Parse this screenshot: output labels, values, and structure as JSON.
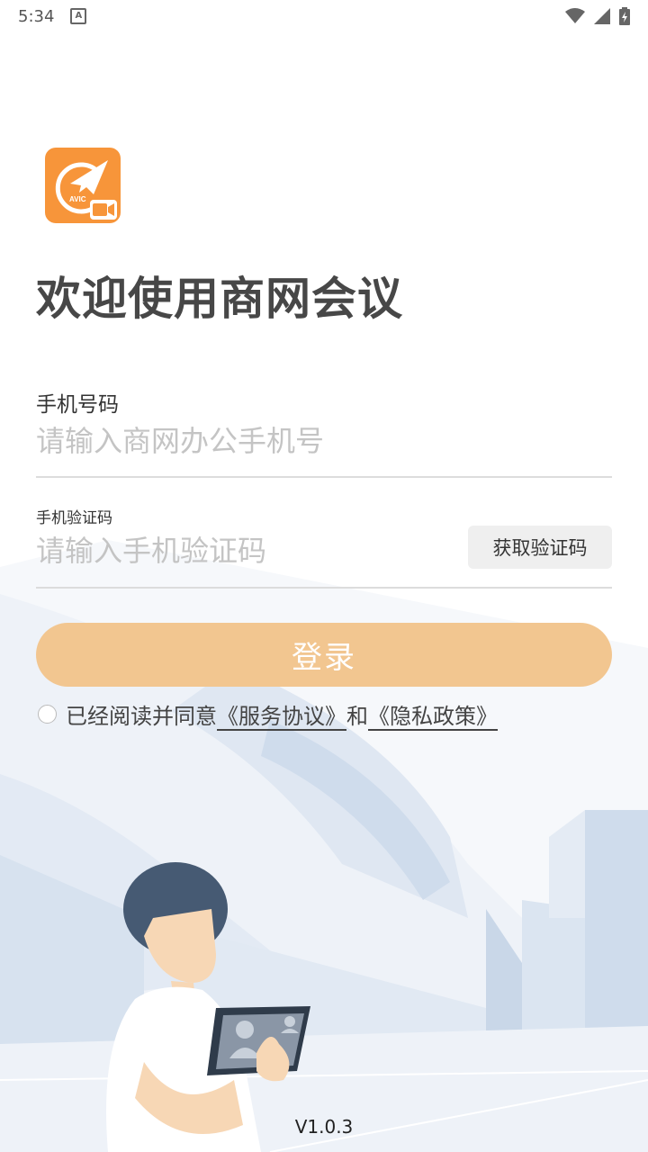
{
  "status_bar": {
    "time": "5:34",
    "notification_icon_letter": "A"
  },
  "app": {
    "logo_text": "AVIC",
    "title": "欢迎使用商网会议"
  },
  "phone": {
    "label": "手机号码",
    "placeholder": "请输入商网办公手机号"
  },
  "code": {
    "label": "手机验证码",
    "placeholder": "请输入手机验证码",
    "get_code_button": "获取验证码"
  },
  "login_button": "登录",
  "agreement": {
    "prefix": "已经阅读并同意",
    "service_link": "《服务协议》",
    "conjunction": "和",
    "privacy_link": "《隐私政策》"
  },
  "version": "V1.0.3",
  "colors": {
    "accent": "#f2c690",
    "logo_orange": "#f7953a",
    "title": "#474747"
  }
}
